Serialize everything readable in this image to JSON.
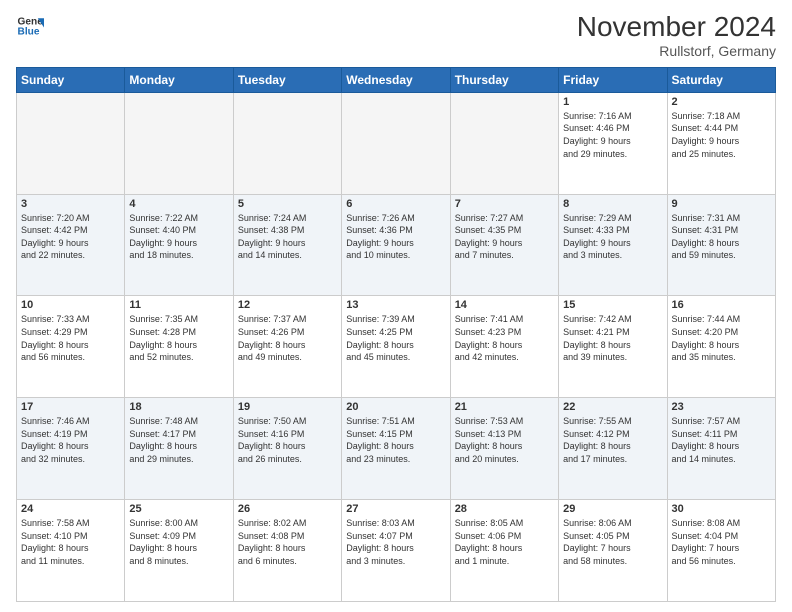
{
  "logo": {
    "line1": "General",
    "line2": "Blue"
  },
  "header": {
    "month": "November 2024",
    "location": "Rullstorf, Germany"
  },
  "weekdays": [
    "Sunday",
    "Monday",
    "Tuesday",
    "Wednesday",
    "Thursday",
    "Friday",
    "Saturday"
  ],
  "weeks": [
    [
      {
        "day": "",
        "info": ""
      },
      {
        "day": "",
        "info": ""
      },
      {
        "day": "",
        "info": ""
      },
      {
        "day": "",
        "info": ""
      },
      {
        "day": "",
        "info": ""
      },
      {
        "day": "1",
        "info": "Sunrise: 7:16 AM\nSunset: 4:46 PM\nDaylight: 9 hours\nand 29 minutes."
      },
      {
        "day": "2",
        "info": "Sunrise: 7:18 AM\nSunset: 4:44 PM\nDaylight: 9 hours\nand 25 minutes."
      }
    ],
    [
      {
        "day": "3",
        "info": "Sunrise: 7:20 AM\nSunset: 4:42 PM\nDaylight: 9 hours\nand 22 minutes."
      },
      {
        "day": "4",
        "info": "Sunrise: 7:22 AM\nSunset: 4:40 PM\nDaylight: 9 hours\nand 18 minutes."
      },
      {
        "day": "5",
        "info": "Sunrise: 7:24 AM\nSunset: 4:38 PM\nDaylight: 9 hours\nand 14 minutes."
      },
      {
        "day": "6",
        "info": "Sunrise: 7:26 AM\nSunset: 4:36 PM\nDaylight: 9 hours\nand 10 minutes."
      },
      {
        "day": "7",
        "info": "Sunrise: 7:27 AM\nSunset: 4:35 PM\nDaylight: 9 hours\nand 7 minutes."
      },
      {
        "day": "8",
        "info": "Sunrise: 7:29 AM\nSunset: 4:33 PM\nDaylight: 9 hours\nand 3 minutes."
      },
      {
        "day": "9",
        "info": "Sunrise: 7:31 AM\nSunset: 4:31 PM\nDaylight: 8 hours\nand 59 minutes."
      }
    ],
    [
      {
        "day": "10",
        "info": "Sunrise: 7:33 AM\nSunset: 4:29 PM\nDaylight: 8 hours\nand 56 minutes."
      },
      {
        "day": "11",
        "info": "Sunrise: 7:35 AM\nSunset: 4:28 PM\nDaylight: 8 hours\nand 52 minutes."
      },
      {
        "day": "12",
        "info": "Sunrise: 7:37 AM\nSunset: 4:26 PM\nDaylight: 8 hours\nand 49 minutes."
      },
      {
        "day": "13",
        "info": "Sunrise: 7:39 AM\nSunset: 4:25 PM\nDaylight: 8 hours\nand 45 minutes."
      },
      {
        "day": "14",
        "info": "Sunrise: 7:41 AM\nSunset: 4:23 PM\nDaylight: 8 hours\nand 42 minutes."
      },
      {
        "day": "15",
        "info": "Sunrise: 7:42 AM\nSunset: 4:21 PM\nDaylight: 8 hours\nand 39 minutes."
      },
      {
        "day": "16",
        "info": "Sunrise: 7:44 AM\nSunset: 4:20 PM\nDaylight: 8 hours\nand 35 minutes."
      }
    ],
    [
      {
        "day": "17",
        "info": "Sunrise: 7:46 AM\nSunset: 4:19 PM\nDaylight: 8 hours\nand 32 minutes."
      },
      {
        "day": "18",
        "info": "Sunrise: 7:48 AM\nSunset: 4:17 PM\nDaylight: 8 hours\nand 29 minutes."
      },
      {
        "day": "19",
        "info": "Sunrise: 7:50 AM\nSunset: 4:16 PM\nDaylight: 8 hours\nand 26 minutes."
      },
      {
        "day": "20",
        "info": "Sunrise: 7:51 AM\nSunset: 4:15 PM\nDaylight: 8 hours\nand 23 minutes."
      },
      {
        "day": "21",
        "info": "Sunrise: 7:53 AM\nSunset: 4:13 PM\nDaylight: 8 hours\nand 20 minutes."
      },
      {
        "day": "22",
        "info": "Sunrise: 7:55 AM\nSunset: 4:12 PM\nDaylight: 8 hours\nand 17 minutes."
      },
      {
        "day": "23",
        "info": "Sunrise: 7:57 AM\nSunset: 4:11 PM\nDaylight: 8 hours\nand 14 minutes."
      }
    ],
    [
      {
        "day": "24",
        "info": "Sunrise: 7:58 AM\nSunset: 4:10 PM\nDaylight: 8 hours\nand 11 minutes."
      },
      {
        "day": "25",
        "info": "Sunrise: 8:00 AM\nSunset: 4:09 PM\nDaylight: 8 hours\nand 8 minutes."
      },
      {
        "day": "26",
        "info": "Sunrise: 8:02 AM\nSunset: 4:08 PM\nDaylight: 8 hours\nand 6 minutes."
      },
      {
        "day": "27",
        "info": "Sunrise: 8:03 AM\nSunset: 4:07 PM\nDaylight: 8 hours\nand 3 minutes."
      },
      {
        "day": "28",
        "info": "Sunrise: 8:05 AM\nSunset: 4:06 PM\nDaylight: 8 hours\nand 1 minute."
      },
      {
        "day": "29",
        "info": "Sunrise: 8:06 AM\nSunset: 4:05 PM\nDaylight: 7 hours\nand 58 minutes."
      },
      {
        "day": "30",
        "info": "Sunrise: 8:08 AM\nSunset: 4:04 PM\nDaylight: 7 hours\nand 56 minutes."
      }
    ]
  ]
}
